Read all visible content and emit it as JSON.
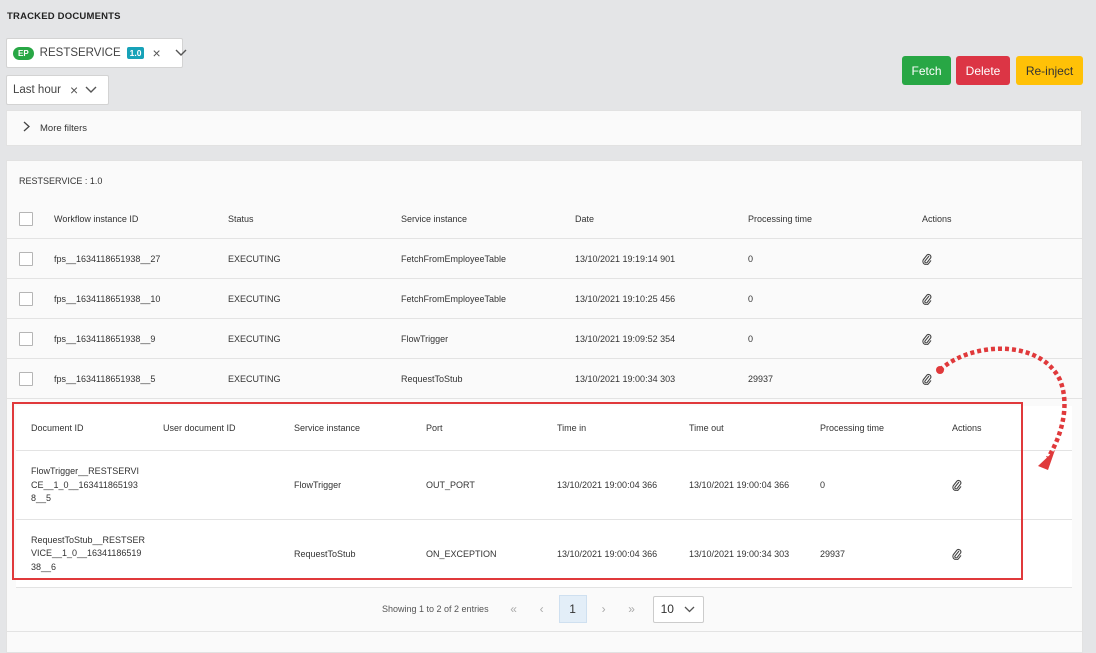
{
  "page_title": "TRACKED DOCUMENTS",
  "service_chip": {
    "badge": "EP",
    "name": "RESTSERVICE",
    "version": "1.0"
  },
  "time_filter": {
    "value": "Last hour"
  },
  "buttons": {
    "fetch": "Fetch",
    "delete": "Delete",
    "reinject": "Re-inject"
  },
  "more_filters": "More filters",
  "section_title": "RESTSERVICE : 1.0",
  "columns": [
    "Workflow instance ID",
    "Status",
    "Service instance",
    "Date",
    "Processing time",
    "Actions"
  ],
  "rows": [
    {
      "workflow_id": "fps__1634118651938__27",
      "status": "EXECUTING",
      "service": "FetchFromEmployeeTable",
      "date": "13/10/2021 19:19:14 901",
      "processing": "0"
    },
    {
      "workflow_id": "fps__1634118651938__10",
      "status": "EXECUTING",
      "service": "FetchFromEmployeeTable",
      "date": "13/10/2021 19:10:25 456",
      "processing": "0"
    },
    {
      "workflow_id": "fps__1634118651938__9",
      "status": "EXECUTING",
      "service": "FlowTrigger",
      "date": "13/10/2021 19:09:52 354",
      "processing": "0"
    },
    {
      "workflow_id": "fps__1634118651938__5",
      "status": "EXECUTING",
      "service": "RequestToStub",
      "date": "13/10/2021 19:00:34 303",
      "processing": "29937"
    }
  ],
  "sub_columns": [
    "Document ID",
    "User document ID",
    "Service instance",
    "Port",
    "Time in",
    "Time out",
    "Processing time",
    "Actions"
  ],
  "sub_rows": [
    {
      "doc_id_lines": [
        "FlowTrigger__RESTSERVI",
        "CE__1_0__163411865193",
        "8__5"
      ],
      "user_doc_id": "",
      "service": "FlowTrigger",
      "port": "OUT_PORT",
      "time_in": "13/10/2021 19:00:04 366",
      "time_out": "13/10/2021 19:00:04 366",
      "processing": "0"
    },
    {
      "doc_id_lines": [
        "RequestToStub__RESTSER",
        "VICE__1_0__16341186519",
        "38__6"
      ],
      "user_doc_id": "",
      "service": "RequestToStub",
      "port": "ON_EXCEPTION",
      "time_in": "13/10/2021 19:00:04 366",
      "time_out": "13/10/2021 19:00:34 303",
      "processing": "29937"
    }
  ],
  "pagination": {
    "info": "Showing 1 to 2 of 2 entries",
    "current_page": "1",
    "page_size": "10"
  },
  "colors": {
    "fetch": "#28a745",
    "delete": "#dc3545",
    "reinject": "#ffc107",
    "annotation": "#e0393b"
  }
}
